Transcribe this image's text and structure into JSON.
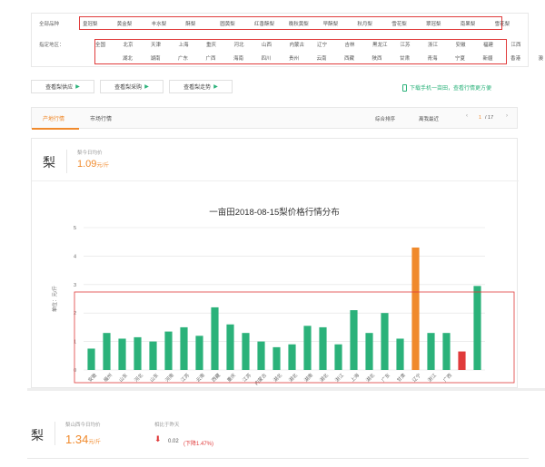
{
  "filter": {
    "variety_label": "全部品种",
    "varieties": [
      "皇冠梨",
      "黄金梨",
      "丰水梨",
      "酥梨",
      "圆黄梨",
      "红香酥梨",
      "晚秋黄梨",
      "早酥梨",
      "秋月梨",
      "雪花梨",
      "翠冠梨",
      "南果梨",
      "雪花梨"
    ],
    "region_label": "指定地区：",
    "regions_row1": [
      "全国",
      "北京",
      "天津",
      "上海",
      "重庆",
      "河北",
      "山西",
      "内蒙古",
      "辽宁",
      "吉林",
      "黑龙江",
      "江苏",
      "浙江",
      "安徽",
      "福建",
      "江西"
    ],
    "regions_row2": [
      "湖北",
      "湖南",
      "广东",
      "广西",
      "海南",
      "四川",
      "贵州",
      "云南",
      "西藏",
      "陕西",
      "甘肃",
      "青海",
      "宁夏",
      "新疆",
      "香港",
      "澳"
    ]
  },
  "buttons": {
    "supply": "查看梨供应",
    "purchase": "查看梨采购",
    "trend": "查看梨走势",
    "download": "下载手机一亩田，查看行情更方便"
  },
  "tabs": {
    "origin": "产地行情",
    "market": "市场行情",
    "sort": "综合排序",
    "search": "离我最近",
    "page_current": "1",
    "page_total": "/ 17",
    "prev": "‹",
    "next": "›"
  },
  "summary": {
    "product": "梨",
    "label": "梨今日均价",
    "price": "1.09",
    "unit": "元/斤"
  },
  "colors": {
    "bar": "#2bb27a",
    "highlight_orange": "#f08a2c",
    "highlight_red": "#e03b3b",
    "accent": "#f08a2c"
  },
  "chart_data": {
    "type": "bar",
    "title": "一亩田2018-08-15梨价格行情分布",
    "ylabel": "单位：元/斤",
    "xlabel": "",
    "ylim": [
      0,
      5
    ],
    "yticks": [
      0,
      1,
      2,
      3,
      4,
      5
    ],
    "grid": true,
    "categories": [
      "安徽",
      "福州",
      "山东",
      "河北",
      "山东",
      "河南",
      "江苏",
      "云南",
      "西藏",
      "重庆",
      "江苏",
      "内蒙古",
      "湖北",
      "湖北",
      "湖南",
      "湖北",
      "浙江",
      "上海",
      "湖北",
      "广东",
      "甘肃",
      "辽宁",
      "浙江",
      "广西"
    ],
    "values": [
      0.75,
      1.3,
      1.1,
      1.15,
      1.0,
      1.35,
      1.5,
      1.2,
      2.2,
      1.6,
      1.3,
      1.0,
      0.8,
      0.9,
      1.55,
      1.5,
      0.9,
      2.1,
      1.3,
      2.0,
      1.1,
      4.3,
      1.3,
      1.3,
      0.65,
      2.95
    ],
    "bar_colors": [
      "#2bb27a",
      "#2bb27a",
      "#2bb27a",
      "#2bb27a",
      "#2bb27a",
      "#2bb27a",
      "#2bb27a",
      "#2bb27a",
      "#2bb27a",
      "#2bb27a",
      "#2bb27a",
      "#2bb27a",
      "#2bb27a",
      "#2bb27a",
      "#2bb27a",
      "#2bb27a",
      "#2bb27a",
      "#2bb27a",
      "#2bb27a",
      "#2bb27a",
      "#2bb27a",
      "#f08a2c",
      "#2bb27a",
      "#2bb27a",
      "#e03b3b",
      "#2bb27a"
    ]
  },
  "footer": {
    "product": "梨",
    "label": "梨山西今日均价",
    "price": "1.34",
    "unit": "元/斤",
    "compare_label": "相比于昨天",
    "change": "0.02",
    "change_detail": "(下降1.47%)"
  }
}
